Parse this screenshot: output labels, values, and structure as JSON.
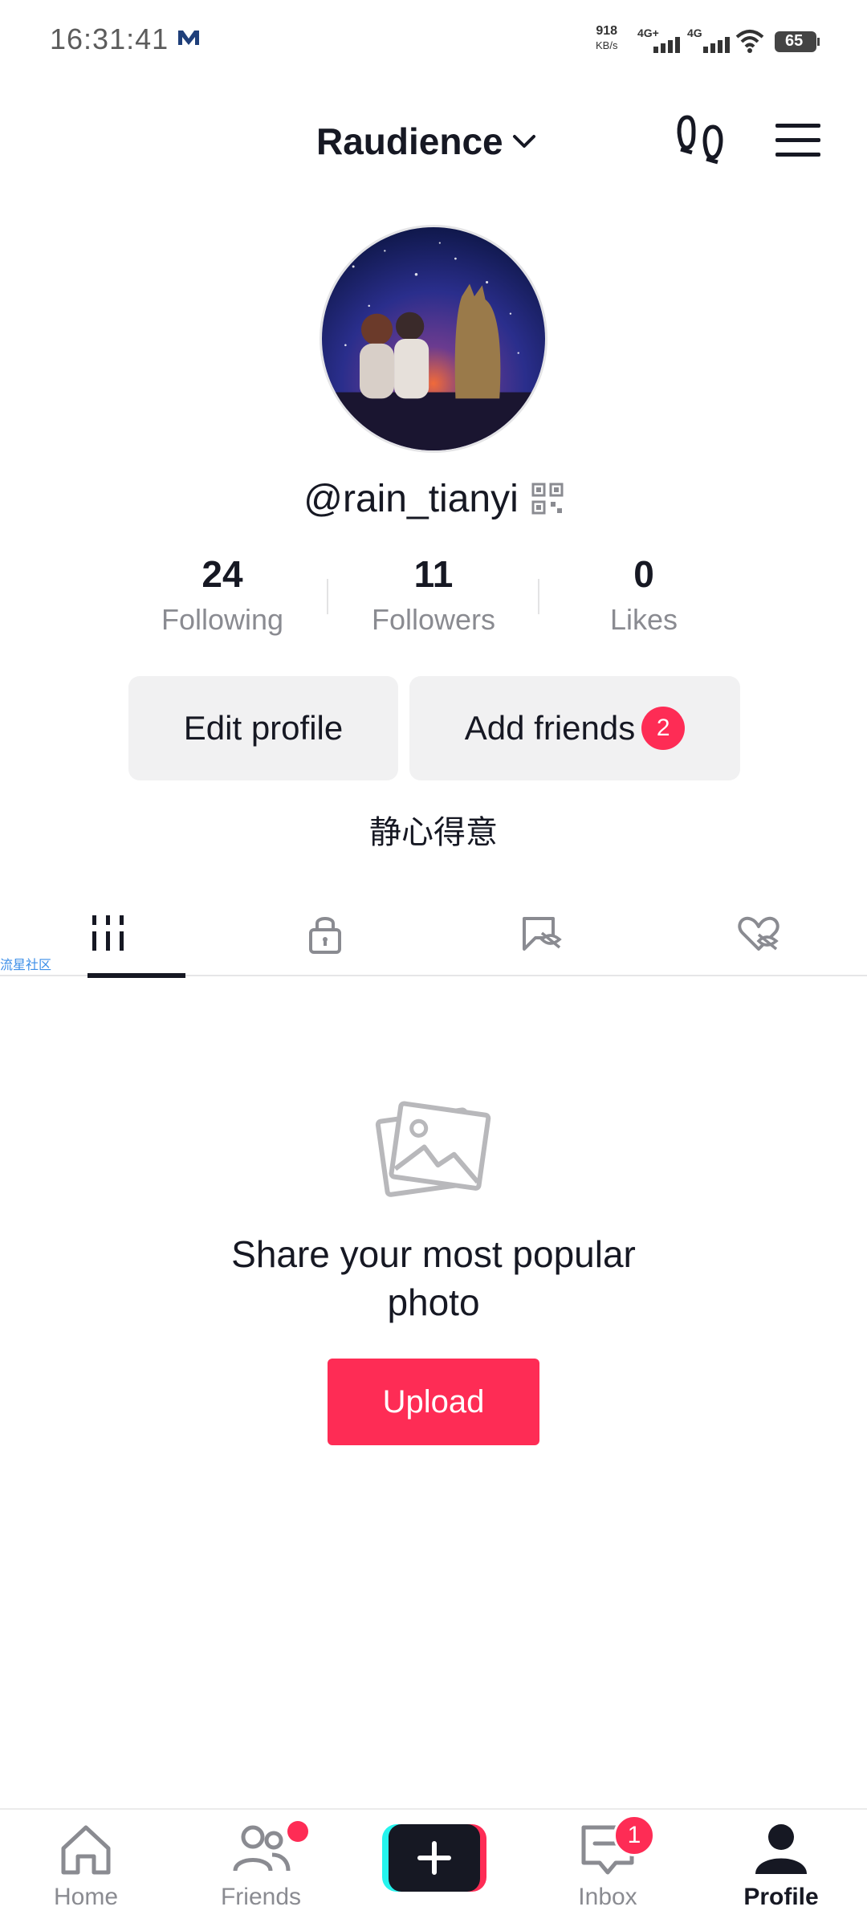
{
  "status_bar": {
    "time": "16:31:41",
    "speed_value": "918",
    "speed_unit": "KB/s",
    "network_1": "4G+",
    "network_2": "4G",
    "battery": "65"
  },
  "header": {
    "account_name": "Raudience"
  },
  "profile": {
    "handle": "@rain_tianyi",
    "bio": "静心得意",
    "stats": [
      {
        "value": "24",
        "label": "Following"
      },
      {
        "value": "11",
        "label": "Followers"
      },
      {
        "value": "0",
        "label": "Likes"
      }
    ],
    "edit_profile_label": "Edit profile",
    "add_friends_label": "Add friends",
    "add_friends_badge": "2"
  },
  "tabs": {
    "items": [
      "grid-icon",
      "lock-icon",
      "reposts-hidden-icon",
      "liked-hidden-icon"
    ],
    "watermark": "流星社区"
  },
  "empty_state": {
    "title_line1": "Share your most popular",
    "title_line2": "photo",
    "upload_label": "Upload"
  },
  "bottom_nav": {
    "home_label": "Home",
    "friends_label": "Friends",
    "inbox_label": "Inbox",
    "inbox_badge": "1",
    "profile_label": "Profile"
  },
  "colors": {
    "accent": "#fe2c55",
    "text": "#161823",
    "muted": "#8a8b91",
    "button_bg": "#f1f1f2"
  }
}
